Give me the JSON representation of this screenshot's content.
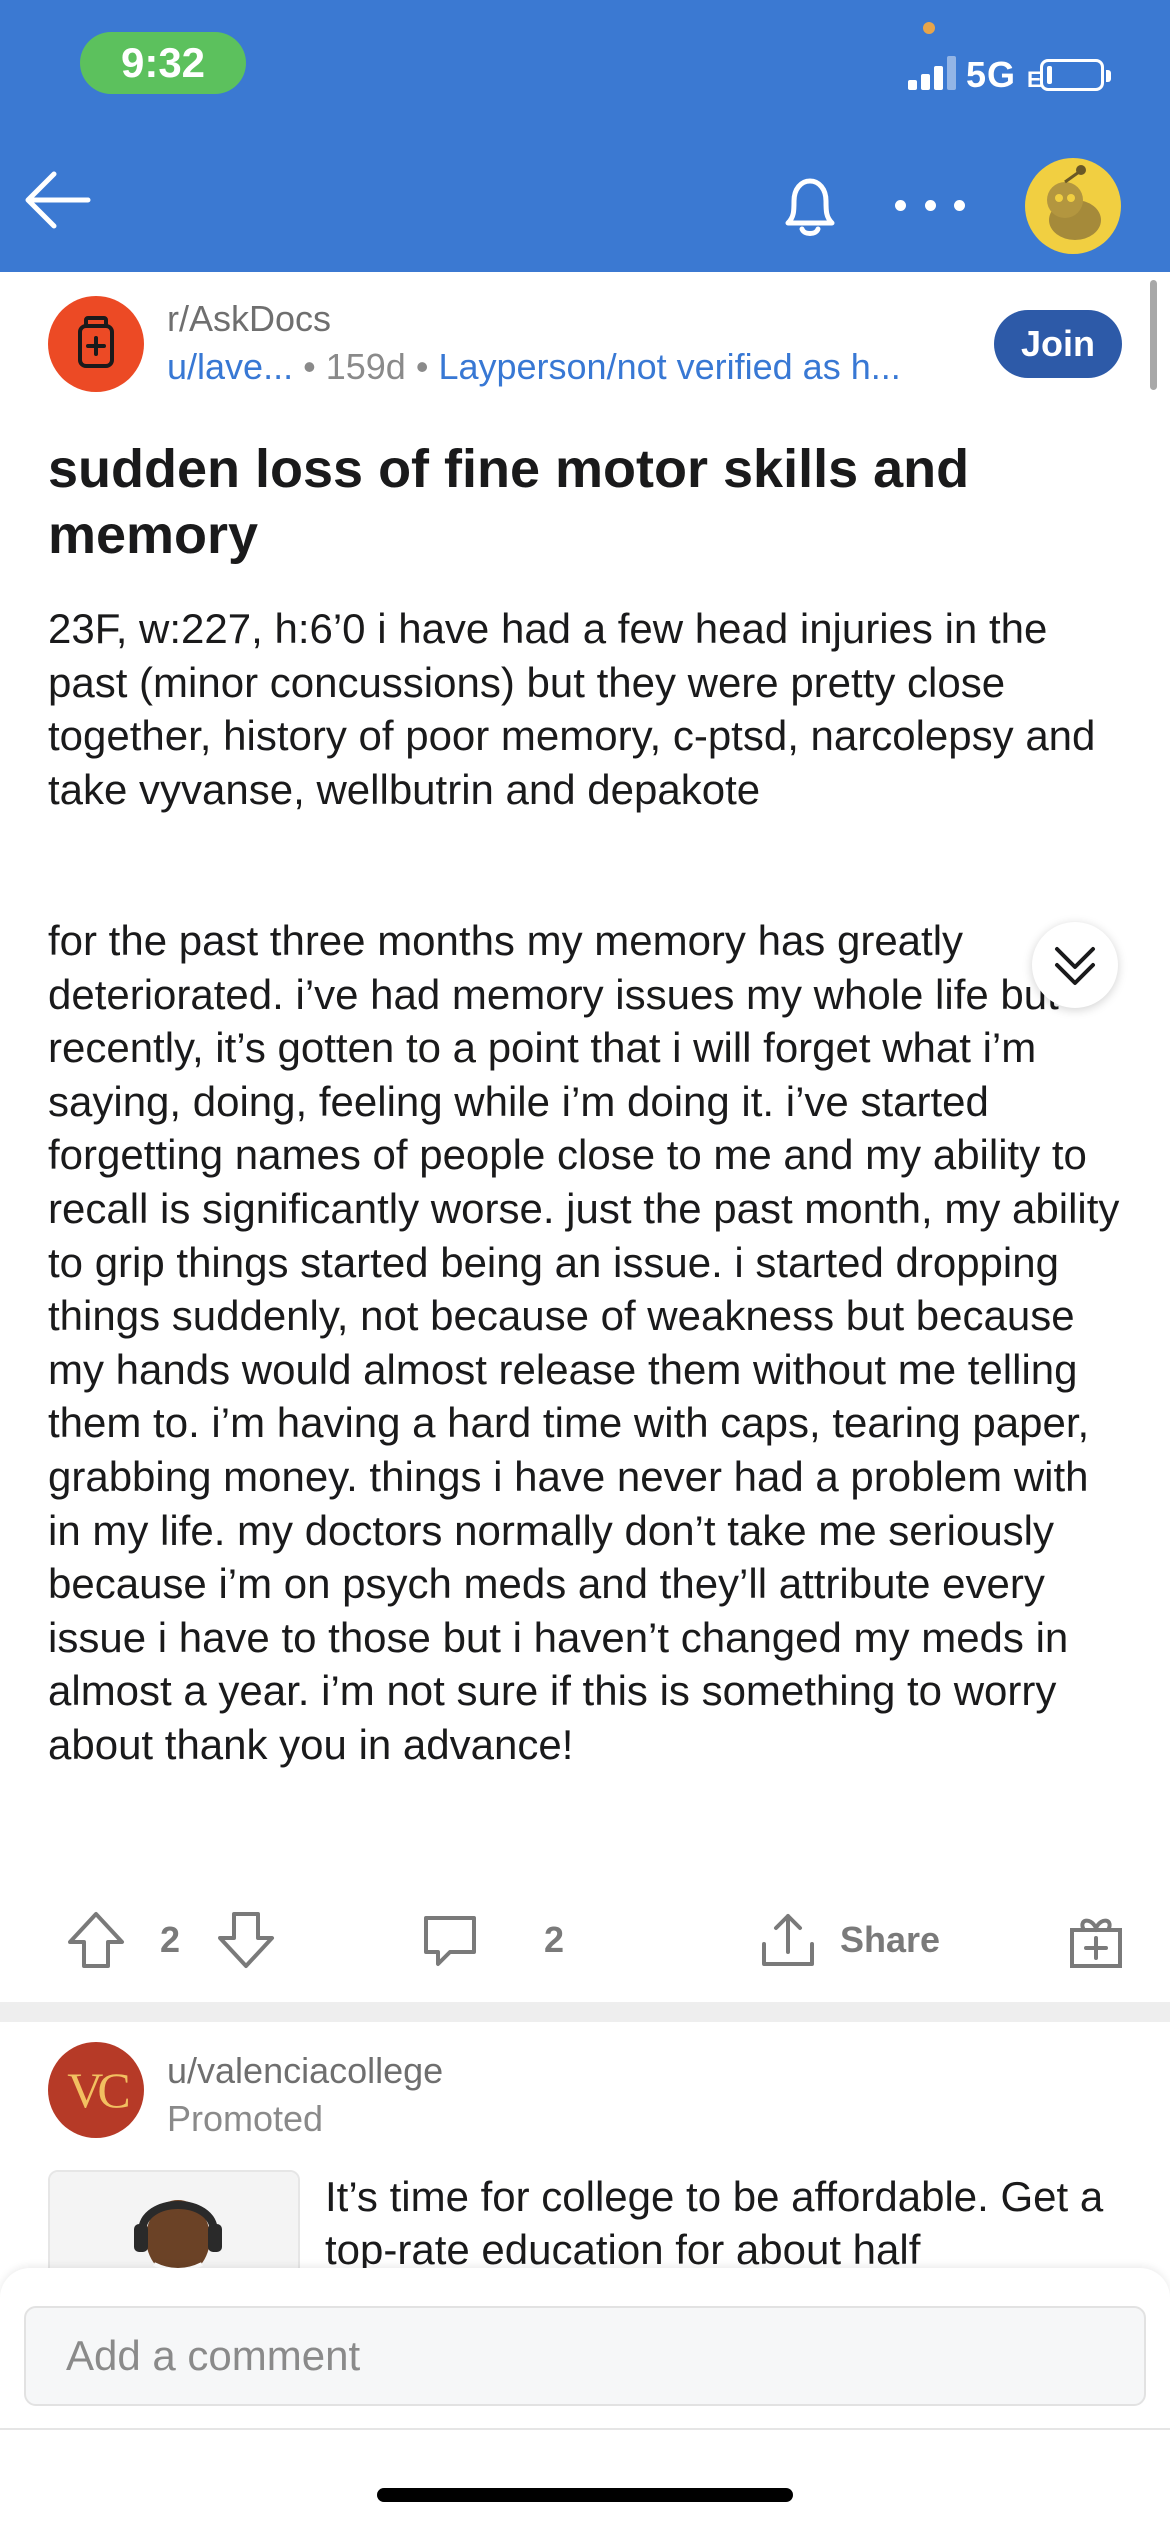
{
  "status_bar": {
    "time": "9:32",
    "network": "5G",
    "network_suffix": "E"
  },
  "header": {
    "back_icon": "arrow-left-icon",
    "bell_icon": "bell-icon",
    "more_icon": "more-dots-icon",
    "avatar_icon": "snoo-avatar-icon",
    "bg_color": "#3b79d2"
  },
  "post": {
    "subreddit": "r/AskDocs",
    "author": "u/lave...",
    "separator": "•",
    "age": "159d",
    "flair": "Layperson/not verified as h...",
    "join_label": "Join",
    "title": "sudden loss of fine motor skills and memory",
    "body_p1": "23F, w:227, h:6’0 i have had a few head injuries in the past (minor concussions) but they were pretty close together, history of poor memory, c-ptsd, narcolepsy and take vyvanse, wellbutrin and depakote",
    "body_p2": "for the past three months my memory has greatly deteriorated. i’ve had memory issues my whole life but recently, it’s gotten to a point that i will forget what i’m saying, doing, feeling while i’m doing it. i’ve started forgetting names of people close to me and my ability to recall is significantly worse. just the past month, my ability to grip things started being an issue. i started dropping things suddenly, not because of weakness but because my hands would almost release them without me telling them to. i’m having a hard time with caps, tearing paper, grabbing money. things i have never had a problem with in my life. my doctors normally don’t take me seriously because i’m on psych meds and they’ll attribute every issue i have to those but i haven’t changed my meds in almost a year. i’m not sure if this is something to worry about thank you in advance!",
    "votes": "2",
    "comments": "2",
    "share_label": "Share"
  },
  "promoted": {
    "user": "u/valenciacollege",
    "label": "Promoted",
    "logo_text": "VC",
    "text": "It’s time for college to be affordable. Get a top-rate education for about half"
  },
  "composer": {
    "placeholder": "Add a comment"
  }
}
